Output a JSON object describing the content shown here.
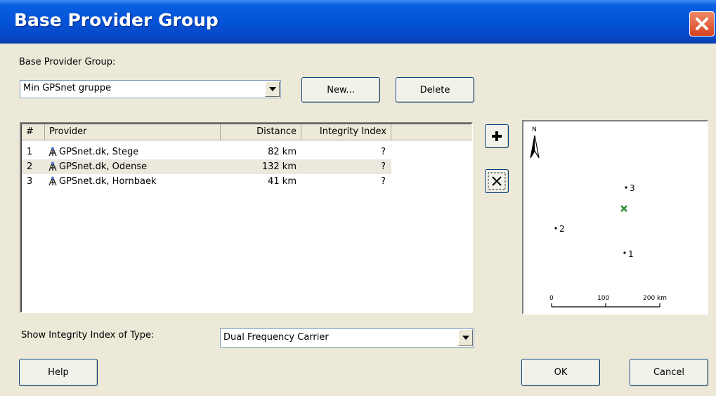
{
  "window": {
    "title": "Base Provider Group"
  },
  "group": {
    "label": "Base Provider Group:",
    "selected": "Min GPSnet gruppe",
    "new_label": "New...",
    "delete_label": "Delete"
  },
  "table": {
    "columns": [
      "#",
      "Provider",
      "Distance",
      "Integrity Index"
    ],
    "rows": [
      {
        "num": "1",
        "provider": "GPSnet.dk, Stege",
        "distance": "82 km",
        "integrity": "?"
      },
      {
        "num": "2",
        "provider": "GPSnet.dk, Odense",
        "distance": "132 km",
        "integrity": "?"
      },
      {
        "num": "3",
        "provider": "GPSnet.dk, Hornbaek",
        "distance": "41 km",
        "integrity": "?"
      }
    ],
    "selected_row": 2
  },
  "side_buttons": {
    "add_icon": "plus-icon",
    "remove_icon": "x-icon"
  },
  "map": {
    "north_label": "N",
    "points": [
      "1",
      "2",
      "3"
    ],
    "current_position_icon": "x-marker-icon",
    "scale_labels": [
      "0",
      "100",
      "200 km"
    ]
  },
  "integrity": {
    "label": "Show Integrity Index of Type:",
    "selected": "Dual Frequency Carrier"
  },
  "footer": {
    "help_label": "Help",
    "ok_label": "OK",
    "cancel_label": "Cancel"
  },
  "colors": {
    "title_bar": "#0453d8",
    "close_button": "#d8431e",
    "dialog_bg": "#ece9d8",
    "marker": "#2e8b2e"
  }
}
